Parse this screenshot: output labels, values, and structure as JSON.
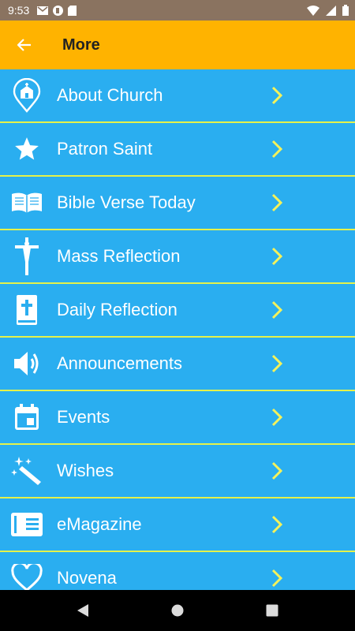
{
  "status_bar": {
    "time": "9:53"
  },
  "app_bar": {
    "title": "More"
  },
  "menu": [
    {
      "label": "About Church",
      "icon": "church-pin-icon"
    },
    {
      "label": "Patron Saint",
      "icon": "star-icon"
    },
    {
      "label": "Bible Verse Today",
      "icon": "open-book-icon"
    },
    {
      "label": "Mass Reflection",
      "icon": "crucifix-icon"
    },
    {
      "label": "Daily Reflection",
      "icon": "bible-icon"
    },
    {
      "label": "Announcements",
      "icon": "speaker-icon"
    },
    {
      "label": "Events",
      "icon": "calendar-icon"
    },
    {
      "label": "Wishes",
      "icon": "magic-wand-icon"
    },
    {
      "label": "eMagazine",
      "icon": "magazine-icon"
    },
    {
      "label": "Novena",
      "icon": "heart-icon"
    }
  ],
  "colors": {
    "app_bar": "#ffb300",
    "list_background": "#2aaef0",
    "divider": "#e5f24a",
    "chevron": "#f4f25a",
    "status_bar": "#8a7360"
  }
}
